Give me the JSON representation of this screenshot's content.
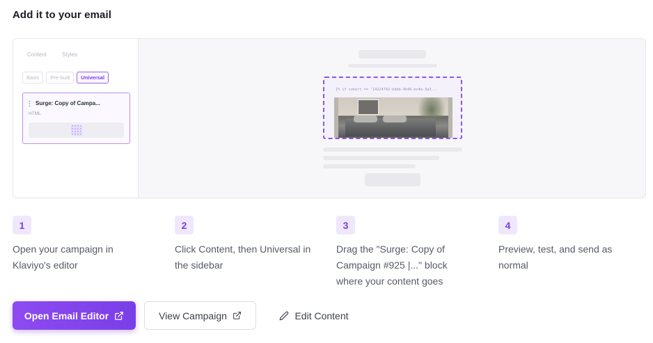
{
  "title": "Add it to your email",
  "preview": {
    "sidebar": {
      "tabs": [
        "Content",
        "Styles"
      ],
      "chips": [
        {
          "label": "Basic",
          "active": false
        },
        {
          "label": "Pre-built",
          "active": false
        },
        {
          "label": "Universal",
          "active": true
        }
      ],
      "block": {
        "title": "Surge: Copy of Campa...",
        "type": "HTML"
      }
    },
    "canvas": {
      "code_snippet": "{% if cohort == '14224742-bdbb-4b46-bc4e-3a3..."
    }
  },
  "steps": [
    {
      "number": "1",
      "text": "Open your campaign in Klaviyo's editor"
    },
    {
      "number": "2",
      "text": "Click Content, then Universal in the sidebar"
    },
    {
      "number": "3",
      "text": "Drag the \"Surge: Copy of Campaign #925 |...\" block where your content goes"
    },
    {
      "number": "4",
      "text": "Preview, test, and send as normal"
    }
  ],
  "actions": {
    "primary_label": "Open Email Editor",
    "secondary_label": "View Campaign",
    "edit_label": "Edit Content"
  },
  "colors": {
    "accent": "#7a3ee8",
    "accent_light": "#efe8fd",
    "border": "#dcdee3"
  },
  "icons": {
    "primary": "external-link-icon",
    "secondary": "external-link-icon",
    "edit": "pencil-icon"
  }
}
